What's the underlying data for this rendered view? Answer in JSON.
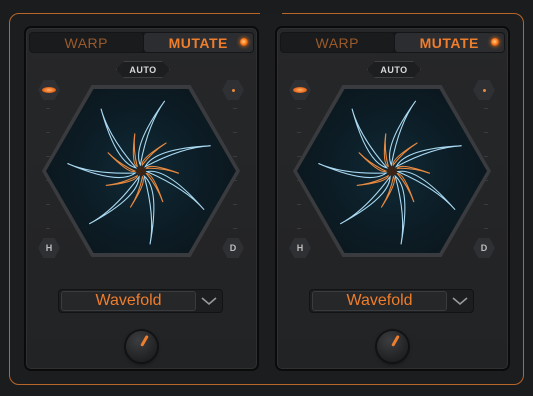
{
  "panels": [
    {
      "mode_buttons": {
        "warp": "WARP",
        "mutate": "MUTATE",
        "active": "MUTATE"
      },
      "auto_label": "AUTO",
      "corner_buttons": {
        "bottom_left": "H",
        "bottom_right": "D"
      },
      "algorithm": "Wavefold"
    },
    {
      "mode_buttons": {
        "warp": "WARP",
        "mutate": "MUTATE",
        "active": "MUTATE"
      },
      "auto_label": "AUTO",
      "corner_buttons": {
        "bottom_left": "H",
        "bottom_right": "D"
      },
      "algorithm": "Wavefold"
    }
  ],
  "colors": {
    "accent": "#ee7d2c",
    "frame": "#b8652a",
    "viz_blue": "#a9d8f0",
    "viz_orange": "#e98a40"
  }
}
